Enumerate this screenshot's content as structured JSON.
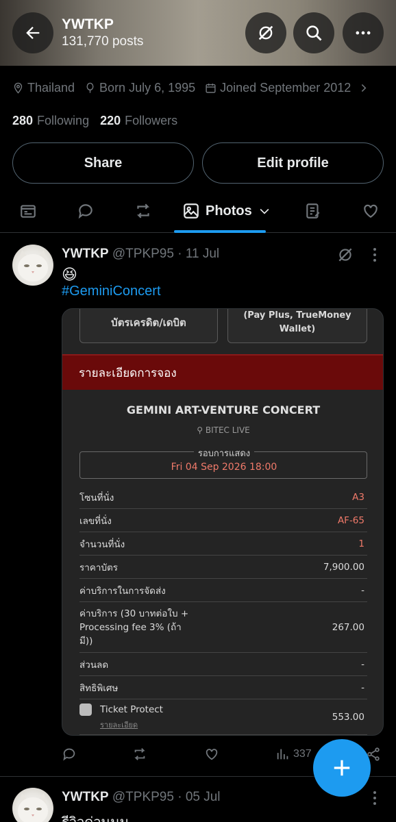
{
  "header": {
    "title": "YWTKP",
    "posts_count": "131,770 posts",
    "icons": [
      "back-arrow-icon",
      "grok-icon",
      "search-icon",
      "more-icon"
    ]
  },
  "profile": {
    "location": "Thailand",
    "born": "Born July 6, 1995",
    "joined": "Joined September 2012",
    "following_count": "280",
    "following_label": "Following",
    "followers_count": "220",
    "followers_label": "Followers",
    "share_label": "Share",
    "edit_label": "Edit profile"
  },
  "tabs": {
    "active_label": "Photos",
    "icons": [
      "newspaper-icon",
      "reply-icon",
      "repost-icon",
      "photos-icon",
      "article-icon",
      "like-icon"
    ]
  },
  "post1": {
    "name": "YWTKP",
    "handle": "@TPKP95",
    "date": "· 11 Jul",
    "emoji": "😆",
    "hashtag": "#GeminiConcert",
    "views_partial": "337",
    "ticket": {
      "pay_left": "บัตรเครดิต/เดบิต",
      "pay_right_line1": "(Pay Plus, TrueMoney",
      "pay_right_line2": "Wallet)",
      "booking_header": "รายละเอียดการจอง",
      "event_title": "GEMINI ART-VENTURE CONCERT",
      "venue": "BITEC LIVE",
      "show_label": "รอบการแสดง",
      "show_value": "Fri 04 Sep 2026 18:00",
      "rows": [
        {
          "label": "โซนที่นั่ง",
          "value": "A3"
        },
        {
          "label": "เลขที่นั่ง",
          "value": "AF-65"
        },
        {
          "label": "จำนวนที่นั่ง",
          "value": "1"
        },
        {
          "label": "ราคาบัตร",
          "value": "7,900.00"
        },
        {
          "label": "ค่าบริการในการจัดส่ง",
          "value": "-"
        },
        {
          "label": "ค่าบริการ (30 บาทต่อใบ + Processing fee 3% (ถ้ามี))",
          "value": "267.00"
        },
        {
          "label": "ส่วนลด",
          "value": "-"
        },
        {
          "label": "สิทธิพิเศษ",
          "value": "-"
        },
        {
          "label": "Ticket Protect",
          "value": "553.00",
          "sub": "รายละเอียด"
        }
      ]
    }
  },
  "post2": {
    "name": "YWTKP",
    "handle": "@TPKP95",
    "date": "· 05 Jul",
    "text": "รีวิวด่วนนน"
  }
}
